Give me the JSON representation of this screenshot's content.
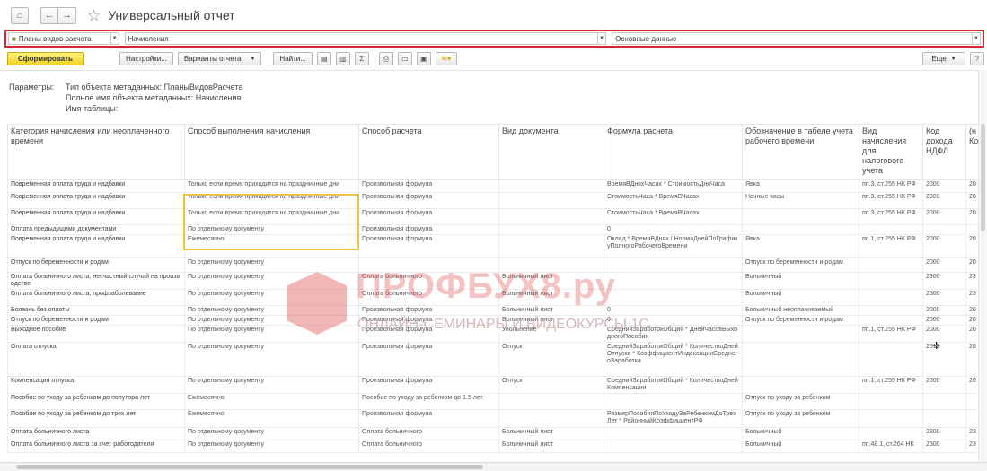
{
  "window": {
    "title": "Универсальный отчет"
  },
  "selectors": {
    "object_type": "Планы видов расчета",
    "object": "Начисления",
    "table": "Основные данные"
  },
  "toolbar": {
    "generate": "Сформировать",
    "settings": "Настройки...",
    "variants": "Варианты отчета",
    "find": "Найти...",
    "more": "Еще",
    "sigma": "Σ",
    "help": "?"
  },
  "params": {
    "label": "Параметры:",
    "line1": "Тип объекта метаданных: ПланыВидовРасчета",
    "line2": "Полное имя объекта метаданных: Начисления",
    "line3": "Имя таблицы:"
  },
  "table": {
    "headers": [
      "Категория начисления или неоплаченного времени",
      "Способ выполнения начисления",
      "Способ расчета",
      "Вид документа",
      "Формула расчета",
      "Обозначение в табеле учета рабочего времени",
      "Вид начисления для налогового учета",
      "Код дохода НДФЛ",
      "(н Ко"
    ],
    "rows": [
      [
        "Повременная оплата труда и надбавки",
        "Только если время приходится на праздничные дни",
        "Произвольная формула",
        "",
        "ВремяВДняхЧасах * СтоимостьДняЧаса",
        "Явка",
        "пп.3, ст.255 НК РФ",
        "2000",
        "20"
      ],
      [
        "Повременная оплата труда и надбавки",
        "Только если время приходится на праздничные дни",
        "Произвольная формула",
        "",
        "СтоимостьЧаса * ВремяВЧасах",
        "Ночные часы",
        "пп.3, ст.255 НК РФ",
        "2000",
        "20"
      ],
      [
        "Повременная оплата труда и надбавки",
        "Только если время приходится на праздничные дни",
        "Произвольная формула",
        "",
        "СтоимостьЧаса * ВремяВЧасах",
        "",
        "пп.3, ст.255 НК РФ",
        "2000",
        "20"
      ],
      [
        "Оплата предыдущими документами",
        "По отдельному документу",
        "Произвольная формула",
        "",
        "0",
        "",
        "",
        "",
        ""
      ],
      [
        "Повременная оплата труда и надбавки",
        "Ежемесячно",
        "Произвольная формула",
        "",
        "Оклад * ВремяВДнях / НормаДнейПоГрафикуПолногоРабочегоВремени",
        "Явка",
        "пп.1, ст.255 НК РФ",
        "2000",
        "20"
      ],
      [
        "Отпуск по беременности и родам",
        "По отдельному документу",
        "",
        "",
        "",
        "Отпуск по беременности и родам",
        "",
        "2000",
        "20"
      ],
      [
        "Оплата больничного листа, несчастный случай на производстве",
        "По отдельному документу",
        "Оплата больничного",
        "Больничный лист",
        "",
        "Больничный",
        "",
        "2300",
        "23"
      ],
      [
        "Оплата больничного листа, профзаболевание",
        "По отдельному документу",
        "Оплата больничного",
        "Больничный лист",
        "",
        "Больничный",
        "",
        "2300",
        "23"
      ],
      [
        "Болезнь без оплаты",
        "По отдельному документу",
        "Произвольная формула",
        "Больничный лист",
        "0",
        "Больничный неоплачиваемый",
        "",
        "2000",
        "20"
      ],
      [
        "Отпуск по беременности и родам",
        "По отдельному документу",
        "Произвольная формула",
        "Больничный лист",
        "0",
        "Отпуск по беременности и родам",
        "",
        "2000",
        "20"
      ],
      [
        "Выходное пособие",
        "По отдельному документу",
        "Произвольная формула",
        "Увольнение",
        "СреднийЗаработокОбщий * ДнейЧасовВыходногоПособия",
        "",
        "пп.1, ст.255 НК РФ",
        "2000",
        "20"
      ],
      [
        "Оплата отпуска",
        "По отдельному документу",
        "Произвольная формула",
        "Отпуск",
        "СреднийЗаработокОбщий * КоличествоДнейОтпуска * КоэффициентИндексацииСреднегоЗаработка",
        "",
        "",
        "2012",
        "20"
      ],
      [
        "Компенсация отпуска",
        "По отдельному документу",
        "Произвольная формула",
        "Отпуск",
        "СреднийЗаработокОбщий * КоличествоДнейКомпенсации",
        "",
        "пп.1, ст.255 НК РФ",
        "2000",
        "20"
      ],
      [
        "Пособие по уходу за ребенком до полутора лет",
        "Ежемесячно",
        "Пособие по уходу за ребенком до 1.5 лет",
        "",
        "",
        "Отпуск по уходу за ребенком",
        "",
        "",
        ""
      ],
      [
        "Пособие по уходу за ребенком до трех лет",
        "Ежемесячно",
        "Произвольная формула",
        "",
        "РазмерПособияПоУходуЗаРебенкомДоТрехЛет * РайонныйКоэффициентРФ",
        "Отпуск по уходу за ребенком",
        "",
        "",
        ""
      ],
      [
        "Оплата больничного листа",
        "По отдельному документу",
        "Оплата больничного",
        "Больничный лист",
        "",
        "Больничный",
        "",
        "2300",
        "23"
      ],
      [
        "Оплата больничного листа за счет работодателя",
        "По отдельному документу",
        "Оплата больничного",
        "Больничный лист",
        "",
        "Больничный",
        "пп.48.1, ст.264 НК",
        "2300",
        "23"
      ]
    ]
  },
  "watermark": {
    "brand": "ПРОФБУХ8.ру",
    "tagline": "ОНЛАЙН-СЕМИНАРЫ И ВИДЕОКУРСЫ 1С"
  },
  "colors": {
    "selector_highlight": "#d8262c",
    "column_highlight": "#f0c43a",
    "primary_button": "#f1d321"
  }
}
